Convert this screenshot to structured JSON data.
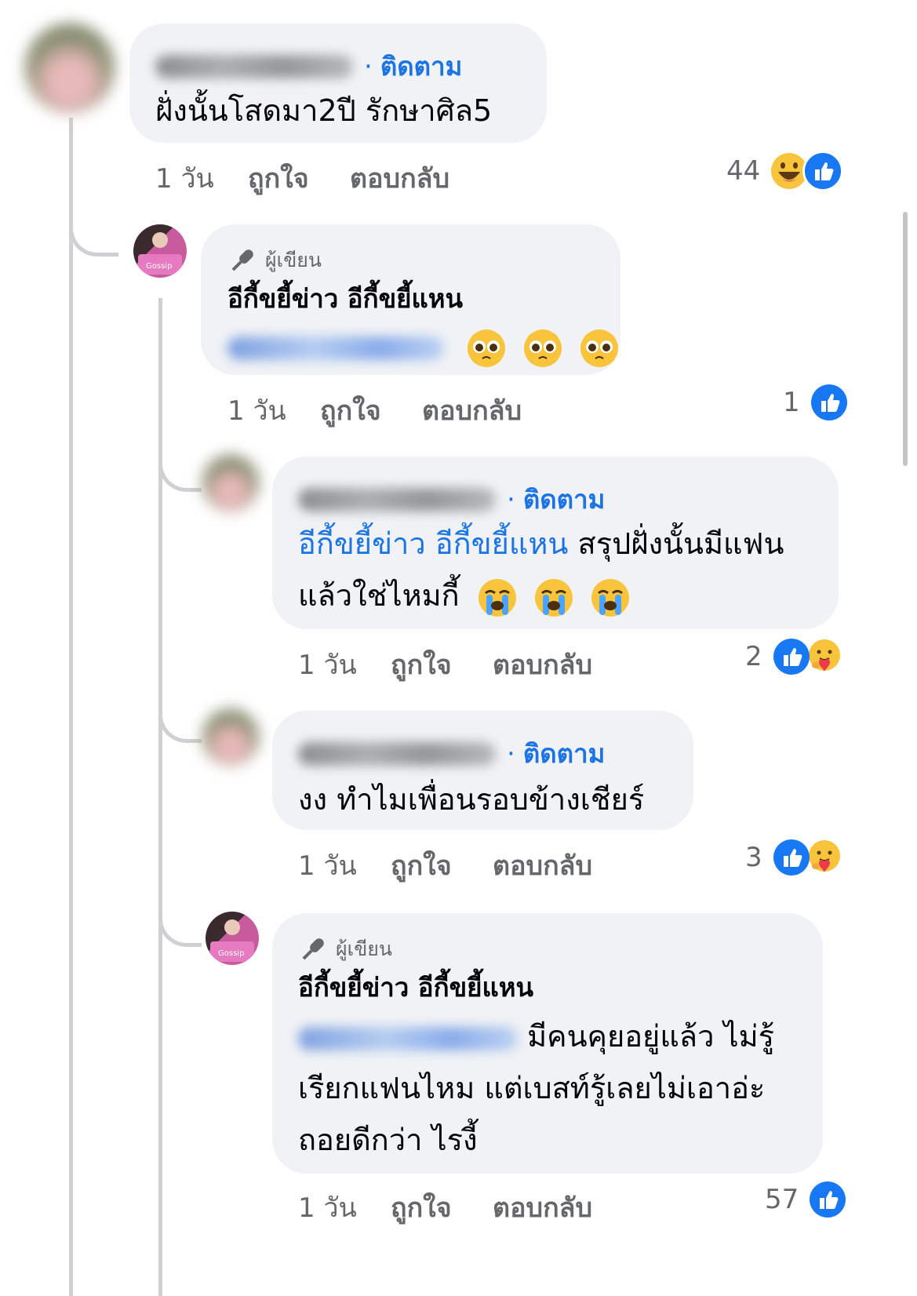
{
  "comments": [
    {
      "name": "Bosso Pinngaadiu",
      "follow_label": "ติดตาม",
      "text": "ฝั่งนั้นโสดมา2ปี รักษาศิล5",
      "time": "1 วัน",
      "like_label": "ถูกใจ",
      "reply_label": "ตอบกลับ",
      "reaction_count": "44",
      "reactions": [
        "laugh",
        "like"
      ]
    },
    {
      "author_badge": "ผู้เขียน",
      "name": "อีกี้ขยี้ข่าว อีกี้ขยี้แหน",
      "mention": "Bosso Pinngaadiu",
      "emojis": [
        "pleading-face",
        "pleading-face",
        "pleading-face"
      ],
      "time": "1 วัน",
      "like_label": "ถูกใจ",
      "reply_label": "ตอบกลับ",
      "reaction_count": "1",
      "reactions": [
        "like"
      ]
    },
    {
      "name": "Bosso Pinngaadiu",
      "follow_label": "ติดตาม",
      "mention": "อีกี้ขยี้ข่าว อีกี้ขยี้แหน",
      "text_line1": "สรุปฝั่งนั้นมีแฟน",
      "text_line2": "แล้วใช่ไหมกี้",
      "emojis": [
        "crying-face",
        "crying-face",
        "crying-face"
      ],
      "time": "1 วัน",
      "like_label": "ถูกใจ",
      "reply_label": "ตอบกลับ",
      "reaction_count": "2",
      "reactions": [
        "like",
        "care"
      ]
    },
    {
      "name": "Bosso Pinngaadiu",
      "follow_label": "ติดตาม",
      "text": "งง ทำไมเพื่อนรอบข้างเชียร์",
      "time": "1 วัน",
      "like_label": "ถูกใจ",
      "reply_label": "ตอบกลับ",
      "reaction_count": "3",
      "reactions": [
        "like",
        "care"
      ]
    },
    {
      "author_badge": "ผู้เขียน",
      "name": "อีกี้ขยี้ข่าว อีกี้ขยี้แหน",
      "mention": "Bosso Pinngaadiu",
      "text_line1": "มีคนคุยอยู่แล้ว ไม่รู้",
      "text_line2": "เรียกแฟนไหม แต่เบสท์รู้เลยไม่เอาอ่ะ",
      "text_line3": "ถอยดีกว่า ไรงี้",
      "time": "1 วัน",
      "like_label": "ถูกใจ",
      "reply_label": "ตอบกลับ",
      "reaction_count": "57",
      "reactions": [
        "like"
      ]
    }
  ],
  "colors": {
    "link_blue": "#1b74e4",
    "bubble_bg": "#f0f2f5",
    "meta_gray": "#65676b",
    "like_blue": "#1877f2"
  }
}
